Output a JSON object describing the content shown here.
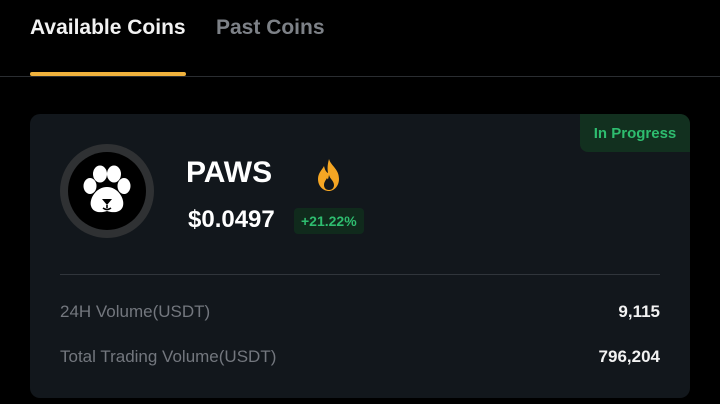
{
  "tabs": {
    "available": "Available Coins",
    "past": "Past Coins"
  },
  "coin": {
    "name": "PAWS",
    "price": "$0.0497",
    "change": "+21.22%",
    "status": "In Progress",
    "icon": "paw-icon",
    "trend_icon": "fire-icon"
  },
  "stats": {
    "volume_24h_label": "24H Volume(USDT)",
    "volume_24h_value": "9,115",
    "total_volume_label": "Total Trading Volume(USDT)",
    "total_volume_value": "796,204"
  },
  "colors": {
    "accent": "#f0b23d",
    "positive": "#2ebd6f",
    "background": "#000000",
    "card": "#12171c"
  }
}
